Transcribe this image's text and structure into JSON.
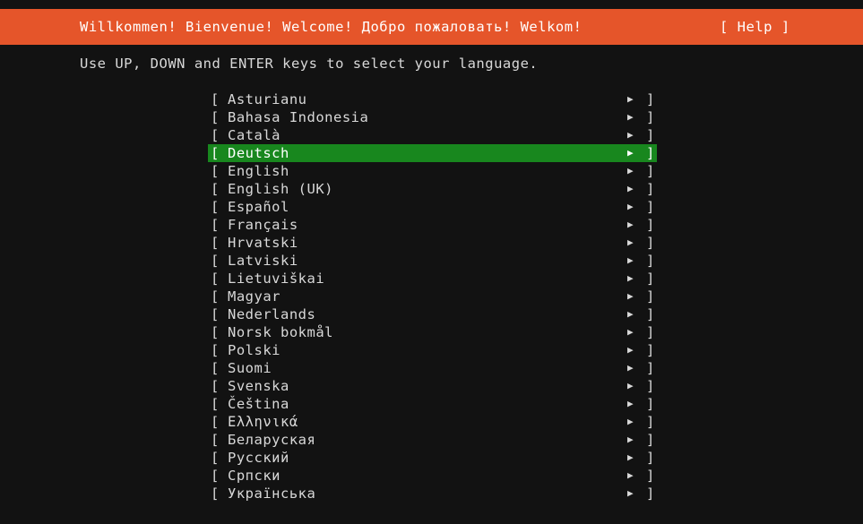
{
  "screen": {
    "background_color": "#121212",
    "accent_color": "#e5552a",
    "selection_color": "#18871e",
    "text_color": "#d8d8d8"
  },
  "header": {
    "title": "Willkommen! Bienvenue! Welcome! Добро пожаловать! Welkom!",
    "help_label": "[ Help ]"
  },
  "instruction": {
    "text": "Use UP, DOWN and ENTER keys to select your language."
  },
  "list": {
    "bracket_left": "[",
    "bracket_right": "]",
    "arrow_icon": "▶",
    "selected_index": 3,
    "items": [
      {
        "label": "Asturianu"
      },
      {
        "label": "Bahasa Indonesia"
      },
      {
        "label": "Català"
      },
      {
        "label": "Deutsch"
      },
      {
        "label": "English"
      },
      {
        "label": "English (UK)"
      },
      {
        "label": "Español"
      },
      {
        "label": "Français"
      },
      {
        "label": "Hrvatski"
      },
      {
        "label": "Latviski"
      },
      {
        "label": "Lietuviškai"
      },
      {
        "label": "Magyar"
      },
      {
        "label": "Nederlands"
      },
      {
        "label": "Norsk bokmål"
      },
      {
        "label": "Polski"
      },
      {
        "label": "Suomi"
      },
      {
        "label": "Svenska"
      },
      {
        "label": "Čeština"
      },
      {
        "label": "Ελληνικά"
      },
      {
        "label": "Беларуская"
      },
      {
        "label": "Русский"
      },
      {
        "label": "Српски"
      },
      {
        "label": "Українська"
      }
    ]
  }
}
